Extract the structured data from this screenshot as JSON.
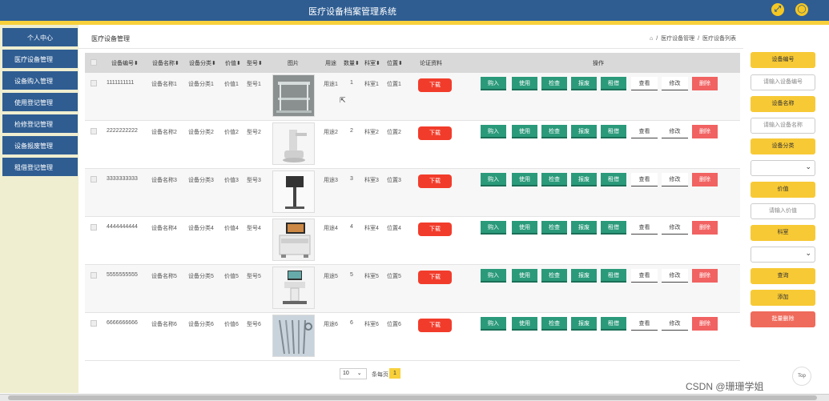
{
  "header": {
    "title": "医疗设备档案管理系统",
    "icons": [
      "fullscreen-icon",
      "user-icon"
    ]
  },
  "sidebar": {
    "items": [
      {
        "label": "个人中心"
      },
      {
        "label": "医疗设备管理"
      },
      {
        "label": "设备购入管理"
      },
      {
        "label": "使用登记管理"
      },
      {
        "label": "检修登记管理"
      },
      {
        "label": "设备报废管理"
      },
      {
        "label": "租借登记管理"
      }
    ]
  },
  "page": {
    "title": "医疗设备管理",
    "breadcrumb": [
      "医疗设备管理",
      "医疗设备列表"
    ],
    "breadcrumb_sep": "/"
  },
  "table": {
    "headers": {
      "code": "设备编号",
      "name": "设备名称",
      "category": "设备分类",
      "price": "价值",
      "model": "型号",
      "image": "图片",
      "usage": "用途",
      "qty": "数量",
      "dept": "科室",
      "location": "位置",
      "cert": "论证资料",
      "ops": "操作"
    },
    "rows": [
      {
        "code": "1111111111",
        "name": "设备名称1",
        "category": "设备分类1",
        "price": "价值1",
        "model": "型号1",
        "image": "glass-cart",
        "usage": "用途1",
        "qty": "1",
        "dept": "科室1",
        "location": "位置1"
      },
      {
        "code": "2222222222",
        "name": "设备名称2",
        "category": "设备分类2",
        "price": "价值2",
        "model": "型号2",
        "image": "robot-arm",
        "usage": "用途2",
        "qty": "2",
        "dept": "科室2",
        "location": "位置2"
      },
      {
        "code": "3333333333",
        "name": "设备名称3",
        "category": "设备分类3",
        "price": "价值3",
        "model": "型号3",
        "image": "monitor-stand",
        "usage": "用途3",
        "qty": "3",
        "dept": "科室3",
        "location": "位置3"
      },
      {
        "code": "4444444444",
        "name": "设备名称4",
        "category": "设备分类4",
        "price": "价值4",
        "model": "型号4",
        "image": "ultrasound-cart",
        "usage": "用途4",
        "qty": "4",
        "dept": "科室4",
        "location": "位置4"
      },
      {
        "code": "5555555555",
        "name": "设备名称5",
        "category": "设备分类5",
        "price": "价值5",
        "model": "型号5",
        "image": "ultrasound-machine",
        "usage": "用途5",
        "qty": "5",
        "dept": "科室5",
        "location": "位置5"
      },
      {
        "code": "6666666666",
        "name": "设备名称6",
        "category": "设备分类6",
        "price": "价值6",
        "model": "型号6",
        "image": "surgical-tools",
        "usage": "用途6",
        "qty": "6",
        "dept": "科室6",
        "location": "位置6"
      }
    ],
    "download_label": "下载",
    "actions": [
      {
        "label": "购入",
        "style": "green"
      },
      {
        "label": "使用",
        "style": "green"
      },
      {
        "label": "检查",
        "style": "green"
      },
      {
        "label": "报废",
        "style": "green"
      },
      {
        "label": "租借",
        "style": "green"
      },
      {
        "label": "查看",
        "style": "plain"
      },
      {
        "label": "修改",
        "style": "plain"
      },
      {
        "label": "删除",
        "style": "red"
      }
    ]
  },
  "pagination": {
    "page_size": "10",
    "per_page_label": "条每页",
    "current_page": "1"
  },
  "filters": {
    "code_label": "设备编号",
    "code_placeholder": "请输入设备编号",
    "name_label": "设备名称",
    "name_placeholder": "请输入设备名称",
    "category_label": "设备分类",
    "category_value": "",
    "price_label": "价值",
    "price_placeholder": "请输入价值",
    "dept_label": "科室",
    "dept_value": "",
    "search_label": "查询",
    "add_label": "添加",
    "batch_delete_label": "批量删除"
  },
  "misc": {
    "top_label": "Top",
    "watermark": "CSDN @珊珊学姐"
  },
  "colors": {
    "primary": "#2f5d92",
    "accent": "#f7d03b",
    "action_green": "#2a9a7a",
    "danger": "#f16262",
    "download": "#f23c2b"
  }
}
